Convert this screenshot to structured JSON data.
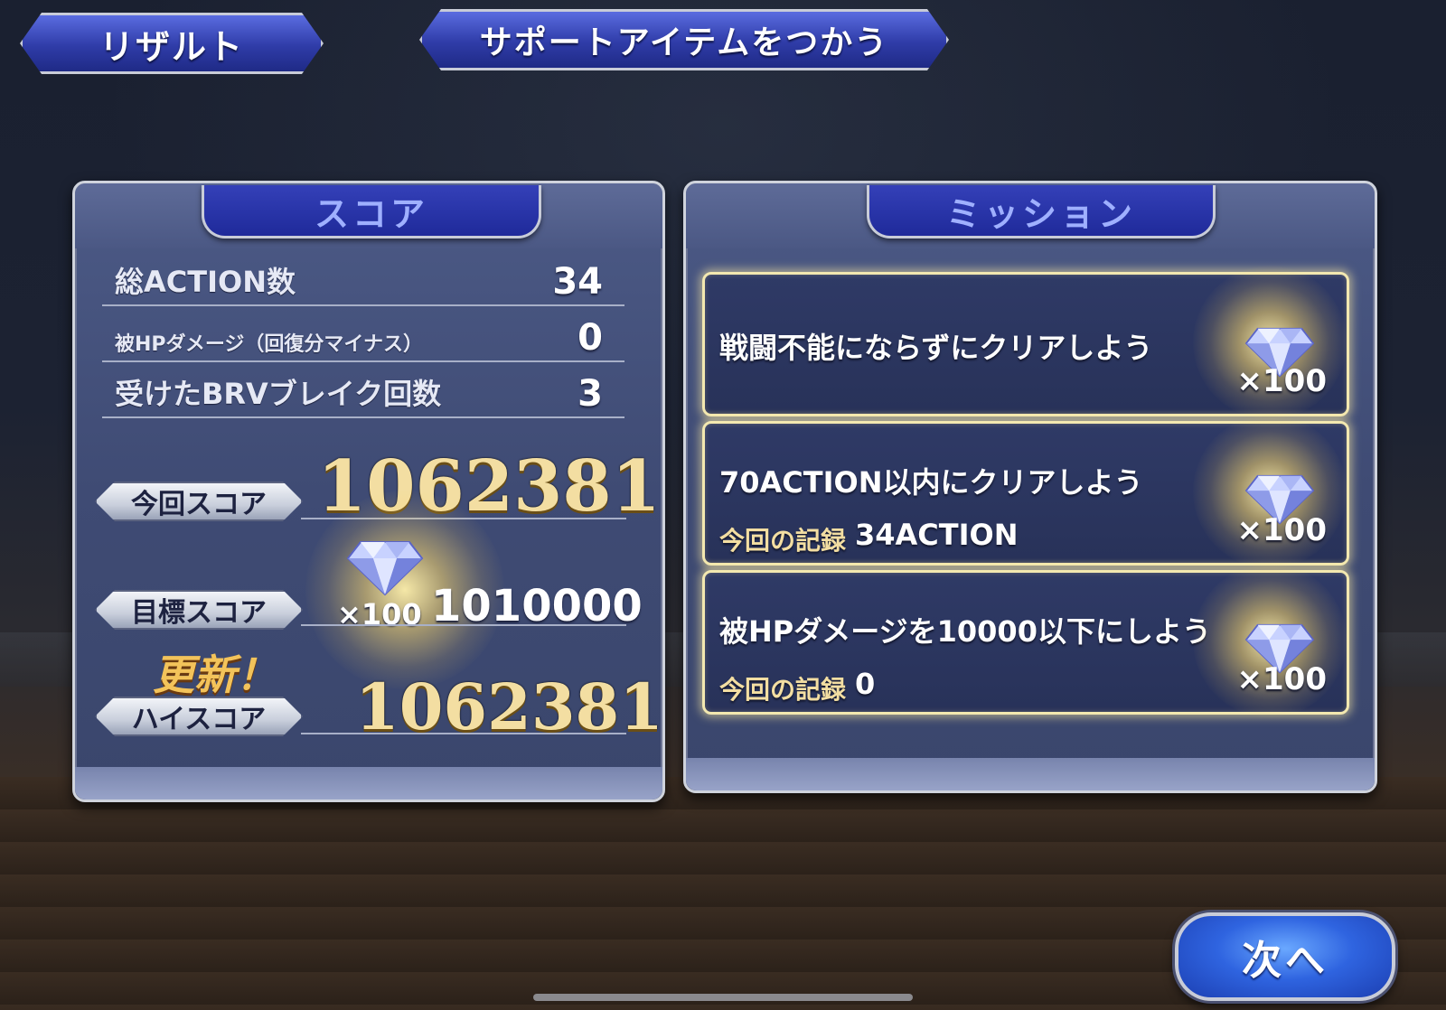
{
  "header": {
    "result_tab": "リザルト",
    "support_item_button": "サポートアイテムをつかう"
  },
  "score": {
    "title": "スコア",
    "rows": [
      {
        "label": "総ACTION数",
        "value": "34"
      },
      {
        "label": "被HPダメージ（回復分マイナス）",
        "value": "0"
      },
      {
        "label": "受けたBRVブレイク回数",
        "value": "3"
      }
    ],
    "current_label": "今回スコア",
    "current_value": "1062381",
    "target_label": "目標スコア",
    "target_value": "1010000",
    "target_reward": "×100",
    "new_record": "更新！",
    "high_label": "ハイスコア",
    "high_value": "1062381"
  },
  "missions": {
    "title": "ミッション",
    "items": [
      {
        "text": "戦闘不能にならずにクリアしよう",
        "reward": "×100",
        "record_label": "",
        "record_value": ""
      },
      {
        "text": "70ACTION以内にクリアしよう",
        "reward": "×100",
        "record_label": "今回の記録",
        "record_value": "34ACTION"
      },
      {
        "text": "被HPダメージを10000以下にしよう",
        "reward": "×100",
        "record_label": "今回の記録",
        "record_value": "0"
      }
    ]
  },
  "next_button": "次へ",
  "colors": {
    "gold": "#f3dea2",
    "panel_blue": "#3f4b74",
    "title_blue": "#1f2a9a",
    "mission_glow": "#f3e8b0"
  },
  "icons": [
    "diamond-gem-icon"
  ]
}
